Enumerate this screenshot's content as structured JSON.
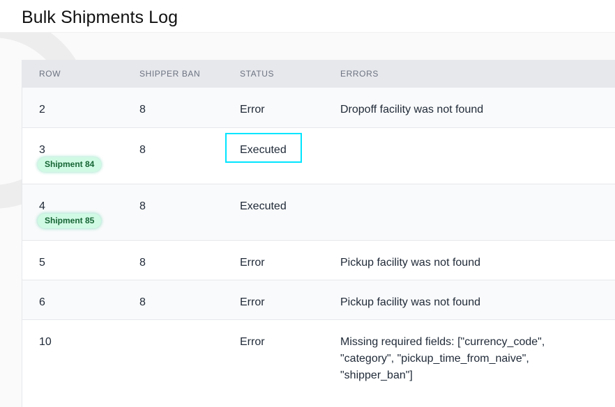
{
  "page": {
    "title": "Bulk Shipments Log"
  },
  "table": {
    "columns": [
      "ROW",
      "SHIPPER BAN",
      "STATUS",
      "ERRORS"
    ],
    "rows": [
      {
        "row": "2",
        "shipper_ban": "8",
        "status": "Error",
        "errors": "Dropoff facility was not found",
        "badge": ""
      },
      {
        "row": "3",
        "shipper_ban": "8",
        "status": "Executed",
        "errors": "",
        "badge": "Shipment 84"
      },
      {
        "row": "4",
        "shipper_ban": "8",
        "status": "Executed",
        "errors": "",
        "badge": "Shipment 85"
      },
      {
        "row": "5",
        "shipper_ban": "8",
        "status": "Error",
        "errors": "Pickup facility was not found",
        "badge": ""
      },
      {
        "row": "6",
        "shipper_ban": "8",
        "status": "Error",
        "errors": "Pickup facility was not found",
        "badge": ""
      },
      {
        "row": "10",
        "shipper_ban": "",
        "status": "Error",
        "errors": "Missing required fields: [\"currency_code\", \"category\", \"pickup_time_from_naive\", \"shipper_ban\"]",
        "badge": ""
      }
    ]
  },
  "colors": {
    "badge_bg": "#d1fae5",
    "badge_text": "#166534",
    "highlight": "#00e5ff"
  }
}
